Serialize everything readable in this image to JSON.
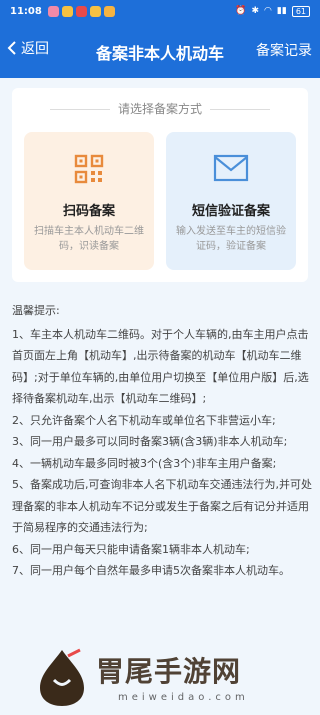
{
  "status_bar": {
    "time": "11:08",
    "battery": "61"
  },
  "nav": {
    "back_label": "返回",
    "title": "备案非本人机动车",
    "record_label": "备案记录"
  },
  "card": {
    "title": "请选择备案方式",
    "options": [
      {
        "label": "扫码备案",
        "desc": "扫描车主本人机动车二维码，识读备案",
        "icon": "qr-code-icon"
      },
      {
        "label": "短信验证备案",
        "desc": "输入发送至车主的短信验证码，验证备案",
        "icon": "envelope-icon"
      }
    ]
  },
  "tips": {
    "heading": "温馨提示:",
    "items": [
      "1、车主本人机动车二维码。对于个人车辆的,由车主用户点击首页面左上角【机动车】,出示待备案的机动车【机动车二维码】;对于单位车辆的,由单位用户切换至【单位用户版】后,选择待备案机动车,出示【机动车二维码】;",
      "2、只允许备案个人名下机动车或单位名下非营运小车;",
      "3、同一用户最多可以同时备案3辆(含3辆)非本人机动车;",
      "4、一辆机动车最多同时被3个(含3个)非车主用户备案;",
      "5、备案成功后,可查询非本人名下机动车交通违法行为,并可处理备案的非本人机动车不记分或发生于备案之后有记分并适用于简易程序的交通违法行为;",
      "6、同一用户每天只能申请备案1辆非本人机动车;",
      "7、同一用户每个自然年最多申请5次备案非本人机动车。"
    ]
  },
  "watermark": {
    "text": "胃尾手游网",
    "url": "meiweidao.com"
  },
  "colors": {
    "primary": "#1e6fd9",
    "scan_bg": "#fdf0e3",
    "sms_bg": "#e5f0fb",
    "scan_icon": "#e88a3c",
    "sms_icon": "#4a8fd9"
  }
}
